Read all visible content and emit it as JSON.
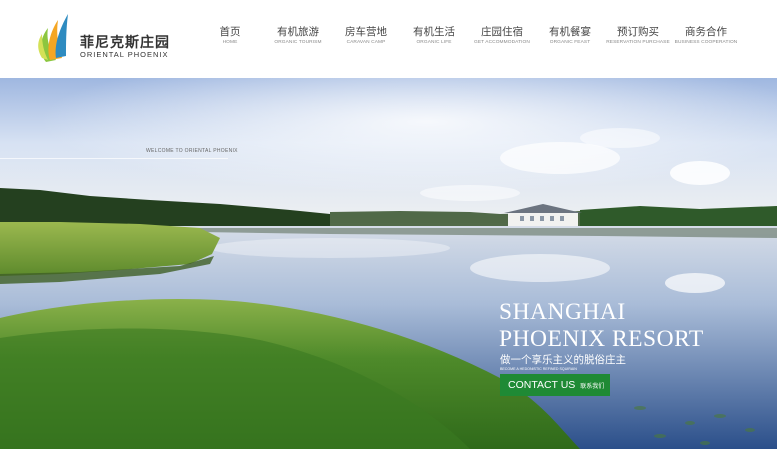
{
  "logo": {
    "name_cn": "菲尼克斯庄园",
    "name_en": "ORIENTAL PHOENIX",
    "icon": "phoenix-flame-logo"
  },
  "nav": [
    {
      "cn": "首页",
      "en": "HOME"
    },
    {
      "cn": "有机旅游",
      "en": "ORGANIC TOURISM"
    },
    {
      "cn": "房车营地",
      "en": "CARAVAN CAMP"
    },
    {
      "cn": "有机生活",
      "en": "ORGANIC LIFE"
    },
    {
      "cn": "庄园住宿",
      "en": "GET ACCOMMODATION"
    },
    {
      "cn": "有机餐宴",
      "en": "ORGANIC FEAST"
    },
    {
      "cn": "预订购买",
      "en": "RESERVATION PURCHASE"
    },
    {
      "cn": "商务合作",
      "en": "BUSINESS COOPERATION"
    }
  ],
  "hero": {
    "welcome": "WELCOME TO ORIENTAL PHOENIX",
    "title_line1": "SHANGHAI",
    "title_line2": "PHOENIX RESORT",
    "subtitle_cn": "做一个享乐主义的脱俗庄主",
    "subtitle_en": "BECOME A HEDONISTIC REFINED SQUIRAIN",
    "contact_en": "CONTACT US",
    "contact_cn": "联系我们"
  },
  "colors": {
    "accent_green": "#1f8a35",
    "nav_text": "#444444"
  }
}
